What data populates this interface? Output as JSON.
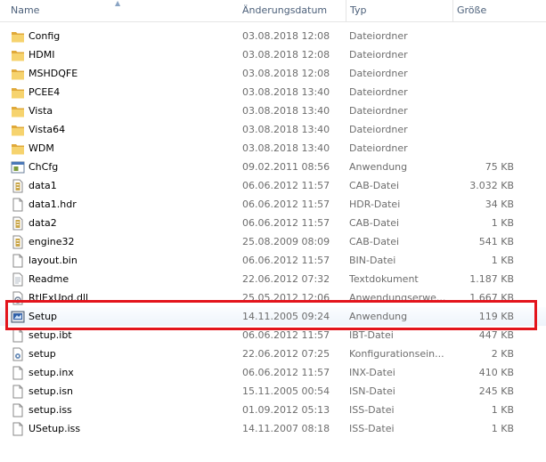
{
  "columns": {
    "name": "Name",
    "date": "Änderungsdatum",
    "type": "Typ",
    "size": "Größe"
  },
  "files": [
    {
      "name": "Config",
      "date": "03.08.2018 12:08",
      "type": "Dateiordner",
      "size": "",
      "icon": "folder-icon"
    },
    {
      "name": "HDMI",
      "date": "03.08.2018 12:08",
      "type": "Dateiordner",
      "size": "",
      "icon": "folder-icon"
    },
    {
      "name": "MSHDQFE",
      "date": "03.08.2018 12:08",
      "type": "Dateiordner",
      "size": "",
      "icon": "folder-icon"
    },
    {
      "name": "PCEE4",
      "date": "03.08.2018 13:40",
      "type": "Dateiordner",
      "size": "",
      "icon": "folder-icon"
    },
    {
      "name": "Vista",
      "date": "03.08.2018 13:40",
      "type": "Dateiordner",
      "size": "",
      "icon": "folder-icon"
    },
    {
      "name": "Vista64",
      "date": "03.08.2018 13:40",
      "type": "Dateiordner",
      "size": "",
      "icon": "folder-icon"
    },
    {
      "name": "WDM",
      "date": "03.08.2018 13:40",
      "type": "Dateiordner",
      "size": "",
      "icon": "folder-icon"
    },
    {
      "name": "ChCfg",
      "date": "09.02.2011 08:56",
      "type": "Anwendung",
      "size": "75 KB",
      "icon": "application-icon"
    },
    {
      "name": "data1",
      "date": "06.06.2012 11:57",
      "type": "CAB-Datei",
      "size": "3.032 KB",
      "icon": "cabinet-file-icon"
    },
    {
      "name": "data1.hdr",
      "date": "06.06.2012 11:57",
      "type": "HDR-Datei",
      "size": "34 KB",
      "icon": "file-icon"
    },
    {
      "name": "data2",
      "date": "06.06.2012 11:57",
      "type": "CAB-Datei",
      "size": "1 KB",
      "icon": "cabinet-file-icon"
    },
    {
      "name": "engine32",
      "date": "25.08.2009 08:09",
      "type": "CAB-Datei",
      "size": "541 KB",
      "icon": "cabinet-file-icon"
    },
    {
      "name": "layout.bin",
      "date": "06.06.2012 11:57",
      "type": "BIN-Datei",
      "size": "1 KB",
      "icon": "file-icon"
    },
    {
      "name": "Readme",
      "date": "22.06.2012 07:32",
      "type": "Textdokument",
      "size": "1.187 KB",
      "icon": "text-document-icon"
    },
    {
      "name": "RtlExUpd.dll",
      "date": "25.05.2012 12:06",
      "type": "Anwendungserwe...",
      "size": "1.667 KB",
      "icon": "dll-file-icon"
    },
    {
      "name": "Setup",
      "date": "14.11.2005 09:24",
      "type": "Anwendung",
      "size": "119 KB",
      "icon": "setup-application-icon"
    },
    {
      "name": "setup.ibt",
      "date": "06.06.2012 11:57",
      "type": "IBT-Datei",
      "size": "447 KB",
      "icon": "file-icon"
    },
    {
      "name": "setup",
      "date": "22.06.2012 07:25",
      "type": "Konfigurationsein...",
      "size": "2 KB",
      "icon": "config-settings-icon"
    },
    {
      "name": "setup.inx",
      "date": "06.06.2012 11:57",
      "type": "INX-Datei",
      "size": "410 KB",
      "icon": "file-icon"
    },
    {
      "name": "setup.isn",
      "date": "15.11.2005 00:54",
      "type": "ISN-Datei",
      "size": "245 KB",
      "icon": "file-icon"
    },
    {
      "name": "setup.iss",
      "date": "01.09.2012 05:13",
      "type": "ISS-Datei",
      "size": "1 KB",
      "icon": "file-icon"
    },
    {
      "name": "USetup.iss",
      "date": "14.11.2007 08:18",
      "type": "ISS-Datei",
      "size": "1 KB",
      "icon": "file-icon"
    }
  ],
  "colors": {
    "highlight": "#e3141c",
    "folder": "#f2c55c",
    "header_text": "#4c607a"
  }
}
